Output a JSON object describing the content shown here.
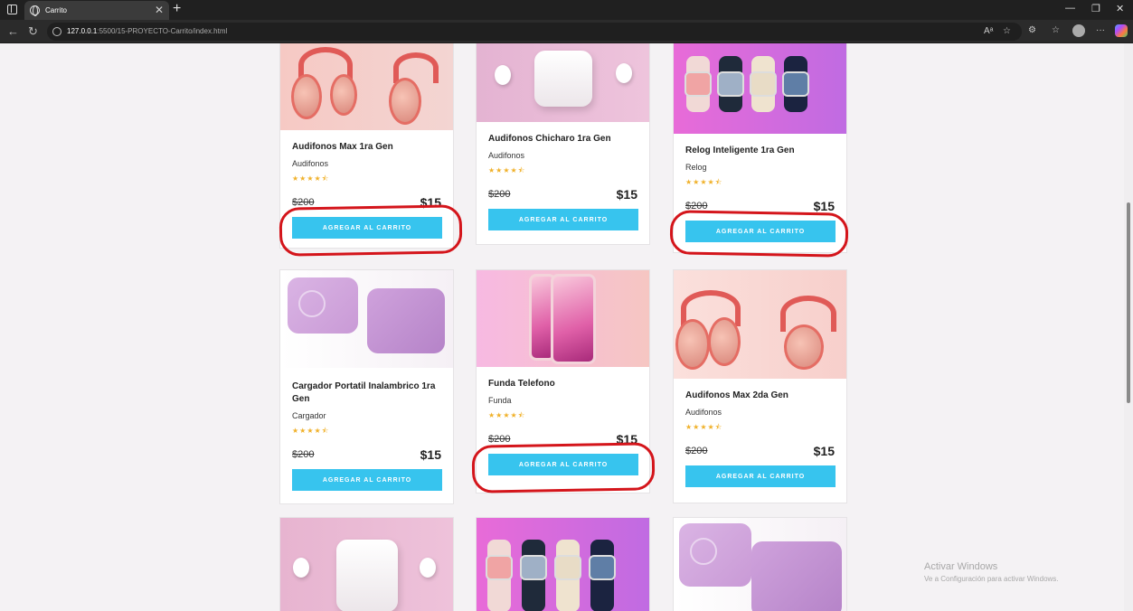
{
  "browser": {
    "tab_title": "Carrito",
    "tab_close": "✕",
    "new_tab": "+",
    "url_host": "127.0.0.1",
    "url_path": ":5500/15-PROYECTO-Carrito/index.html"
  },
  "products": [
    {
      "name": "Audifonos Max 1ra Gen",
      "category": "Audifonos",
      "stars": "★★★★⯪",
      "old_price": "$200",
      "price": "$15",
      "button": "AGREGAR AL CARRITO"
    },
    {
      "name": "Audifonos Chicharo 1ra Gen",
      "category": "Audifonos",
      "stars": "★★★★⯪",
      "old_price": "$200",
      "price": "$15",
      "button": "AGREGAR AL CARRITO"
    },
    {
      "name": "Relog Inteligente 1ra Gen",
      "category": "Relog",
      "stars": "★★★★⯪",
      "old_price": "$200",
      "price": "$15",
      "button": "AGREGAR AL CARRITO"
    },
    {
      "name": "Cargador Portatil Inalambrico 1ra Gen",
      "category": "Cargador",
      "stars": "★★★★⯪",
      "old_price": "$200",
      "price": "$15",
      "button": "AGREGAR AL CARRITO"
    },
    {
      "name": "Funda Telefono",
      "category": "Funda",
      "stars": "★★★★⯪",
      "old_price": "$200",
      "price": "$15",
      "button": "AGREGAR AL CARRITO"
    },
    {
      "name": "Audifonos Max 2da Gen",
      "category": "Audifonos",
      "stars": "★★★★⯪",
      "old_price": "$200",
      "price": "$15",
      "button": "AGREGAR AL CARRITO"
    }
  ],
  "watermark": {
    "line1": "Activar Windows",
    "line2": "Ve a Configuración para activar Windows."
  },
  "colors": {
    "button": "#37c4ee",
    "highlight": "#d4151b",
    "stars": "#f0b12a"
  }
}
